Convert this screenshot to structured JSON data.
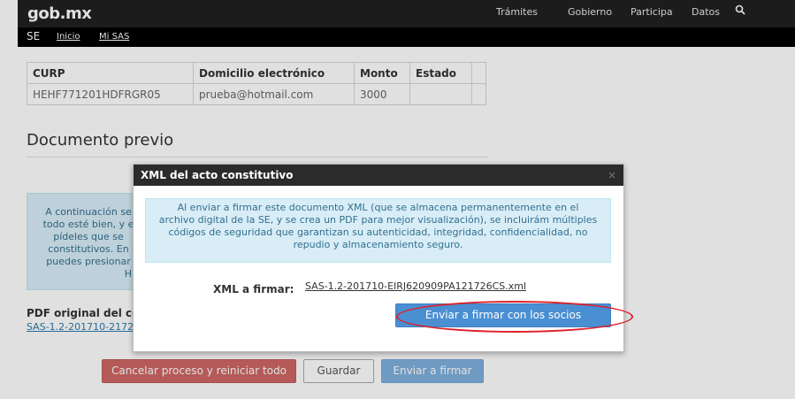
{
  "header": {
    "logo": "gob.mx",
    "nav": [
      "Trámites",
      "Gobierno",
      "Participa",
      "Datos"
    ],
    "icons": {
      "search": "search-icon"
    }
  },
  "subnav": {
    "section": "SE",
    "links": [
      "Inicio",
      "Mi SAS"
    ]
  },
  "table": {
    "headers": [
      "CURP",
      "Domicilio electrónico",
      "Monto",
      "Estado",
      ""
    ],
    "rows": [
      [
        "HEHF771201HDFRGR05",
        "prueba@hotmail.com",
        "3000",
        "",
        ""
      ]
    ]
  },
  "document": {
    "title": "Documento previo",
    "info_lines": [
      "A continuación se",
      "todo esté bien, y e",
      "pídeles que se",
      "constitutivos. En",
      "puedes presionar",
      "H"
    ],
    "pdf_label": "PDF original del con",
    "pdf_link": "SAS-1.2-201710-2172"
  },
  "buttons": {
    "cancel": "Cancelar proceso y reiniciar todo",
    "save": "Guardar",
    "send": "Enviar a firmar"
  },
  "modal": {
    "title": "XML del acto constitutivo",
    "close": "×",
    "info_lines": [
      "Al enviar a firmar este documento XML (que se almacena permanentemente en el",
      "archivo digital de la SE, y se crea un PDF para mejor visualización), se incluirám múltiples",
      "códigos de seguridad que garantizan su autenticidad, integridad, confidencialidad, no",
      "repudio y almacenamiento seguro."
    ],
    "xml_label": "XML a firmar:",
    "xml_file": "SAS-1.2-201710-EIRJ620909PA121726CS.xml",
    "send_button": "Enviar a firmar con los socios"
  },
  "colors": {
    "highlight": "#e0202a",
    "primary": "#4a8fd2",
    "danger": "#cf6765",
    "info_bg": "#d9edf7"
  }
}
